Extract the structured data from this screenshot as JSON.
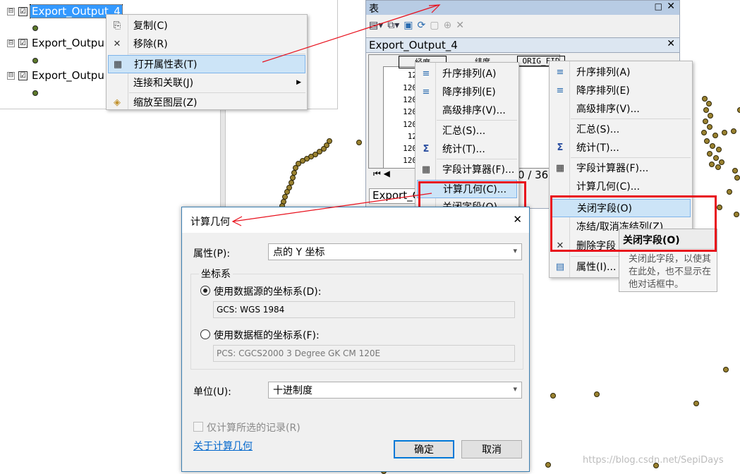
{
  "toc": {
    "layers": [
      {
        "name": "Export_Output_4",
        "selected": true
      },
      {
        "name": "Export_Outpu",
        "selected": false
      },
      {
        "name": "Export_Outpu",
        "selected": false
      }
    ],
    "expander": "⊟",
    "check": "☑"
  },
  "layer_menu": {
    "items": [
      {
        "label": "复制(C)",
        "icon": "copy-icon"
      },
      {
        "label": "移除(R)",
        "icon": "remove-icon"
      },
      {
        "label": "打开属性表(T)",
        "icon": "table-icon"
      },
      {
        "label": "连接和关联(J)",
        "icon": ""
      },
      {
        "label": "缩放至图层(Z)",
        "icon": "zoom-layer-icon"
      }
    ]
  },
  "table_window": {
    "title": "表",
    "tab_name": "Export_Output_4",
    "headers": [
      "经度",
      "纬度",
      "ORIG_FID"
    ],
    "cells": [
      "12",
      "120",
      "120",
      "120",
      "120",
      "12",
      "120",
      "120"
    ],
    "record_info": "0 / 36",
    "bottom_tab": "Export_O"
  },
  "field_menu_left": {
    "items": [
      "升序排列(A)",
      "降序排列(E)",
      "高级排序(V)...",
      "汇总(S)...",
      "统计(T)...",
      "字段计算器(F)...",
      "计算几何(C)...",
      "关闭字段(O)"
    ]
  },
  "field_menu_right": {
    "items": [
      "升序排列(A)",
      "降序排列(E)",
      "高级排序(V)...",
      "汇总(S)...",
      "统计(T)...",
      "字段计算器(F)...",
      "计算几何(C)...",
      "关闭字段(O)",
      "冻结/取消冻结列(Z)",
      "删除字段",
      "属性(I)..."
    ]
  },
  "tooltip": {
    "title": "关闭字段(O)",
    "lines": [
      "关闭此字段，以使其",
      "在此处，也不显示在",
      "他对话框中。"
    ]
  },
  "dialog": {
    "title": "计算几何",
    "property_label": "属性(P):",
    "property_value": "点的 Y 坐标",
    "coord_group": "坐标系",
    "radio_source": "使用数据源的坐标系(D):",
    "source_cs": "GCS: WGS 1984",
    "radio_frame": "使用数据框的坐标系(F):",
    "frame_cs": "PCS: CGCS2000 3 Degree GK CM 120E",
    "unit_label": "单位(U):",
    "unit_value": "十进制度",
    "selected_only": "仅计算所选的记录(R)",
    "about_link": "关于计算几何",
    "ok": "确定",
    "cancel": "取消"
  },
  "watermark": "https://blog.csdn.net/SepiDays",
  "colors": {
    "highlight": "#cce4f7",
    "selected_layer": "#3399ff",
    "red_annotation": "#e8101c",
    "map_point": "#9a8230"
  }
}
